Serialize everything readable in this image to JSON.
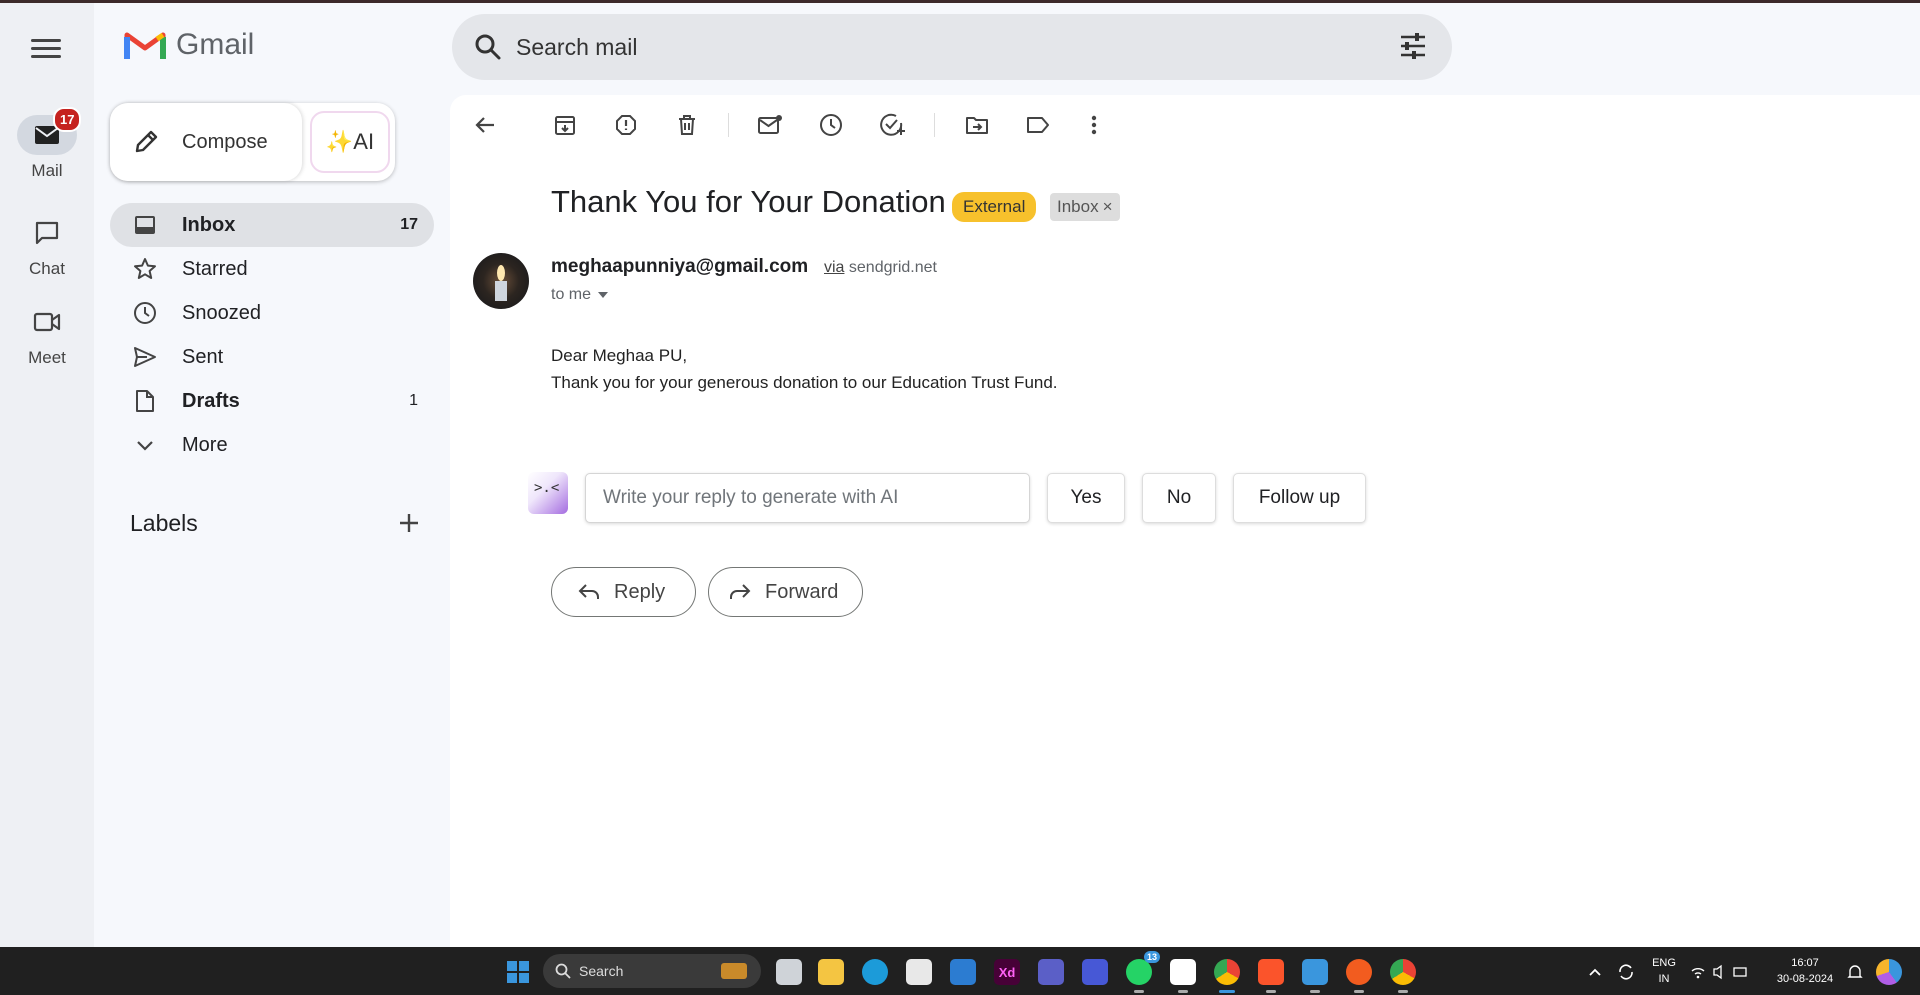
{
  "app": {
    "name": "Gmail"
  },
  "rail": {
    "items": [
      {
        "label": "Mail",
        "icon": "mail-icon",
        "badge": "17",
        "active": true
      },
      {
        "label": "Chat",
        "icon": "chat-icon"
      },
      {
        "label": "Meet",
        "icon": "video-icon"
      }
    ]
  },
  "search": {
    "placeholder": "Search mail"
  },
  "compose": {
    "label": "Compose",
    "ai_label": "✨AI"
  },
  "nav": {
    "items": [
      {
        "label": "Inbox",
        "count": "17",
        "icon": "inbox-icon",
        "active": true
      },
      {
        "label": "Starred",
        "count": "",
        "icon": "star-icon"
      },
      {
        "label": "Snoozed",
        "count": "",
        "icon": "clock-icon"
      },
      {
        "label": "Sent",
        "count": "",
        "icon": "send-icon"
      },
      {
        "label": "Drafts",
        "count": "1",
        "icon": "draft-icon"
      },
      {
        "label": "More",
        "count": "",
        "icon": "chevron-down-icon"
      }
    ],
    "labels_title": "Labels"
  },
  "toolbar": {
    "icons": [
      "back-arrow-icon",
      "archive-icon",
      "report-spam-icon",
      "delete-icon",
      "mark-unread-icon",
      "snooze-icon",
      "add-task-icon",
      "move-to-icon",
      "label-icon",
      "more-vert-icon"
    ]
  },
  "email": {
    "subject": "Thank You for Your Donation",
    "tag_external": "External",
    "tag_inbox": "Inbox",
    "tag_close": "×",
    "sender": "meghaapunniya@gmail.com",
    "via_word": "via",
    "via_domain": "sendgrid.net",
    "to": "to me",
    "body_line1": "Dear Meghaa PU,",
    "body_line2": "Thank you for your generous donation to our Education Trust Fund."
  },
  "reply_ai": {
    "logo_text": ">.<",
    "placeholder": "Write your reply to generate with AI",
    "chips": [
      "Yes",
      "No",
      "Follow up"
    ]
  },
  "actions": {
    "reply": "Reply",
    "forward": "Forward"
  },
  "taskbar": {
    "search_label": "Search",
    "whatsapp_badge": "13",
    "lang_line1": "ENG",
    "lang_line2": "IN",
    "time": "16:07",
    "date": "30-08-2024",
    "colors": {
      "windows": "#3a96dd",
      "explorer": "#f4c542",
      "edge": "#1c9bd9",
      "xd": "#470137",
      "teams": "#5b5fc7",
      "whatsapp": "#25d366",
      "brave": "#fb542b"
    }
  }
}
